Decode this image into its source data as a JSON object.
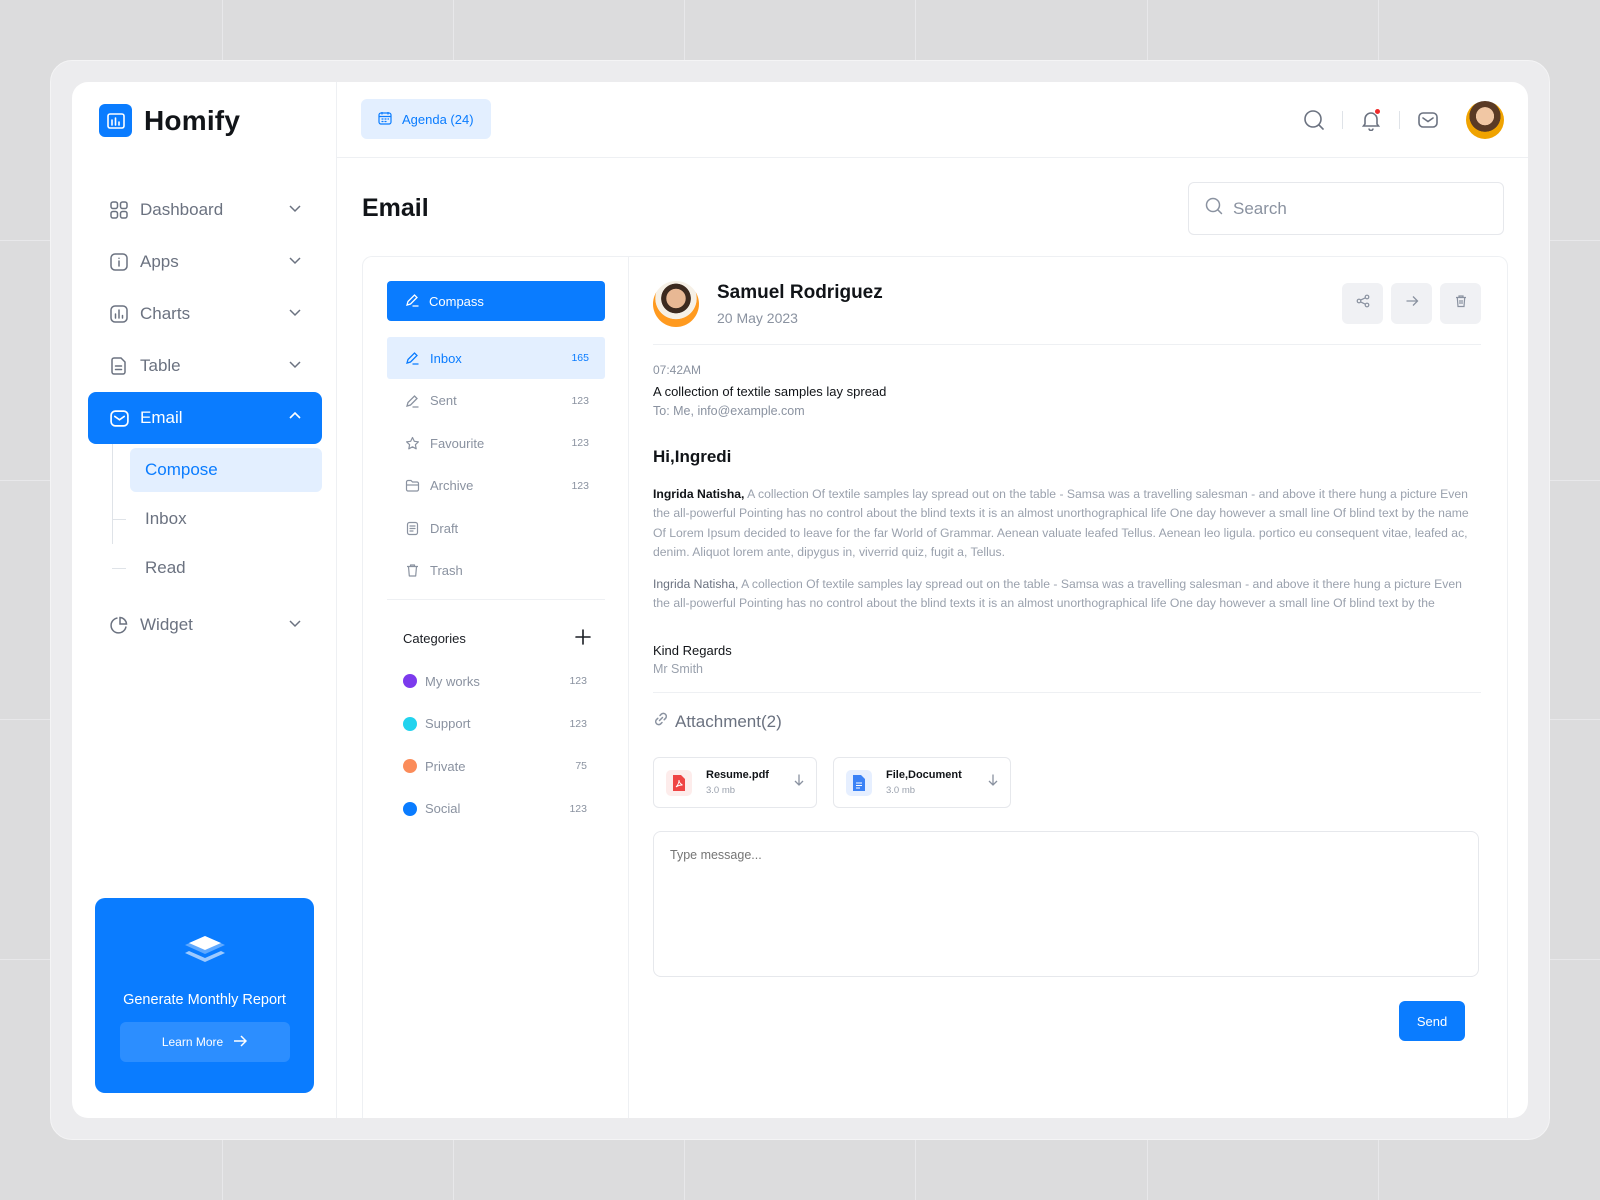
{
  "brand": {
    "name": "Homify"
  },
  "sidebar": {
    "items": [
      {
        "label": "Dashboard",
        "icon": "grid-icon"
      },
      {
        "label": "Apps",
        "icon": "info-square-icon"
      },
      {
        "label": "Charts",
        "icon": "bar-chart-icon"
      },
      {
        "label": "Table",
        "icon": "document-icon"
      },
      {
        "label": "Email",
        "icon": "mail-icon",
        "active": true
      },
      {
        "label": "Widget",
        "icon": "pie-chart-icon"
      }
    ],
    "email_sub": [
      "Compose",
      "Inbox",
      "Read"
    ],
    "promo": {
      "title": "Generate Monthly Report",
      "button": "Learn More"
    }
  },
  "topbar": {
    "agenda": "Agenda (24)"
  },
  "page": {
    "title": "Email",
    "search_placeholder": "Search"
  },
  "folders": {
    "compose": "Compass",
    "items": [
      {
        "label": "Inbox",
        "count": "165",
        "icon": "pen-icon"
      },
      {
        "label": "Sent",
        "count": "123",
        "icon": "pen-icon"
      },
      {
        "label": "Favourite",
        "count": "123",
        "icon": "star-icon"
      },
      {
        "label": "Archive",
        "count": "123",
        "icon": "folder-icon"
      },
      {
        "label": "Draft",
        "count": "",
        "icon": "document-icon"
      },
      {
        "label": "Trash",
        "count": "",
        "icon": "trash-icon"
      }
    ],
    "categories_title": "Categories",
    "categories": [
      {
        "label": "My works",
        "count": "123",
        "color": "#7c3aed"
      },
      {
        "label": "Support",
        "count": "123",
        "color": "#22d3ee"
      },
      {
        "label": "Private",
        "count": "75",
        "color": "#fb8c5a"
      },
      {
        "label": "Social",
        "count": "123",
        "color": "#0a7cff"
      }
    ]
  },
  "message": {
    "sender": "Samuel Rodriguez",
    "date": "20 May 2023",
    "time": "07:42AM",
    "subject": "A collection of textile samples lay spread",
    "to": "To: Me, info@example.com",
    "greeting": "Hi,Ingredi",
    "para1_name": "Ingrida Natisha,",
    "para1": " A collection Of textile samples lay spread out on the table - Samsa was a travelling salesman - and above it there hung a picture Even the all-powerful Pointing has no control about the blind texts it is an almost unorthographical life One day however a small line Of blind text by the name Of Lorem Ipsum decided to leave for the far  World of Grammar. Aenean valuate leafed Tellus. Aenean leo ligula. portico eu consequent vitae, leafed ac, denim. Aliquot lorem ante, dipygus in, viverrid quiz, fugit a, Tellus.",
    "para2_name": "Ingrida Natisha,",
    "para2": " A collection Of textile samples lay spread out on the table - Samsa was a travelling salesman - and above it there hung a picture Even the all-powerful Pointing has no control about the blind texts it is an almost unorthographical life One day however a small line Of blind text by the",
    "regards": "Kind Regards",
    "regards_name": "Mr Smith",
    "attachment_title": "Attachment(2)",
    "files": [
      {
        "name": "Resume.pdf",
        "size": "3.0 mb"
      },
      {
        "name": "File,Document",
        "size": "3.0 mb"
      }
    ],
    "reply_placeholder": "Type message...",
    "send": "Send"
  }
}
